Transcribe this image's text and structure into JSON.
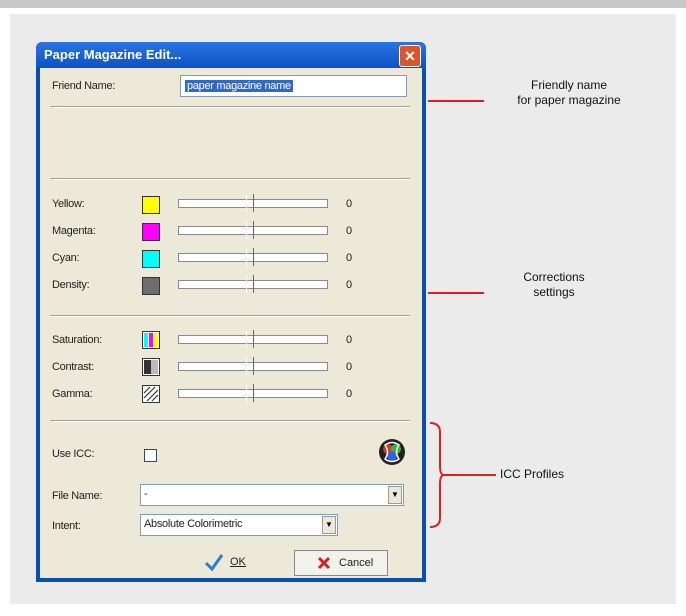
{
  "dialog": {
    "title": "Paper Magazine Edit...",
    "close_glyph": "✕",
    "friend_name_label": "Friend Name:",
    "friend_name_value": "paper magazine name",
    "sliders": [
      {
        "label": "Yellow:",
        "color": "#ffff00",
        "value": "0"
      },
      {
        "label": "Magenta:",
        "color": "#ff00ff",
        "value": "0"
      },
      {
        "label": "Cyan:",
        "color": "#00ffff",
        "value": "0"
      },
      {
        "label": "Density:",
        "color": "#6e6e6e",
        "value": "0"
      },
      {
        "label": "Saturation:",
        "icon": "saturation-icon",
        "value": "0"
      },
      {
        "label": "Contrast:",
        "icon": "contrast-icon",
        "value": "0"
      },
      {
        "label": "Gamma:",
        "icon": "gamma-icon",
        "value": "0"
      }
    ],
    "use_icc_label": "Use ICC:",
    "use_icc_checked": false,
    "file_name_label": "File Name:",
    "file_name_value": "-",
    "intent_label": "Intent:",
    "intent_value": "Absolute Colorimetric",
    "ok_label": "OK",
    "cancel_label": "Cancel"
  },
  "annotations": {
    "friendly_name": [
      "Friendly name",
      "for paper magazine"
    ],
    "corrections": [
      "Corrections",
      "settings"
    ],
    "icc_profiles": "ICC Profiles",
    "line_color": "#e02020"
  }
}
